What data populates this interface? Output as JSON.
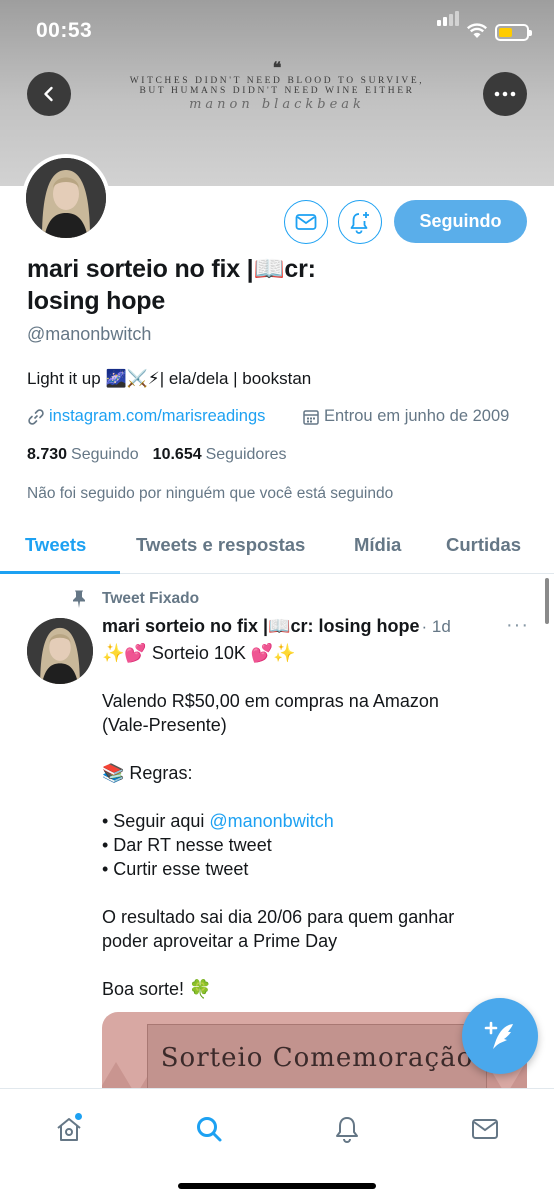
{
  "status_bar": {
    "time": "00:53"
  },
  "banner": {
    "quote_mark": "❝",
    "quote_line1": "Witches didn't need blood to survive,",
    "quote_line2": "but humans didn't need wine either",
    "signature": "manon blackbeak"
  },
  "profile": {
    "name_line1": "mari sorteio no fix |📖cr:",
    "name_line2": "losing hope",
    "handle": "@manonbwitch",
    "bio": "Light it up 🌌⚔️⚡| ela/dela | bookstan",
    "link": "instagram.com/marisreadings",
    "joined": "Entrou em junho de 2009",
    "following_count": "8.730",
    "following_label": "Seguindo",
    "followers_count": "10.654",
    "followers_label": "Seguidores",
    "not_followed_text": "Não foi seguido por ninguém que você está seguindo",
    "follow_button_label": "Seguindo"
  },
  "tabs": [
    {
      "label": "Tweets",
      "active": true
    },
    {
      "label": "Tweets e respostas",
      "active": false
    },
    {
      "label": "Mídia",
      "active": false
    },
    {
      "label": "Curtidas",
      "active": false
    }
  ],
  "tweet": {
    "pinned_label": "Tweet Fixado",
    "author": "mari sorteio no fix |📖cr: losing hope",
    "time": "· 1d",
    "more": "···",
    "line1": "✨💕 Sorteio 10K 💕✨",
    "line2": "Valendo R$50,00 em compras na Amazon",
    "line3": "(Vale-Presente)",
    "line4": "📚 Regras:",
    "line5_prefix": "• Seguir aqui ",
    "line5_mention": "@manonbwitch",
    "line6": "• Dar RT nesse tweet",
    "line7": "• Curtir esse tweet",
    "line8": "O resultado sai dia 20/06 para quem ganhar",
    "line9": "poder aproveitar a Prime Day",
    "line10": "Boa sorte! 🍀",
    "media_title": "Sorteio Comemoração"
  },
  "colors": {
    "accent": "#1da1f2",
    "follow_button": "#5aaeea",
    "secondary_text": "#657786",
    "primary_text": "#14171a"
  },
  "icons": {
    "back": "chevron-left-icon",
    "more": "more-horizontal-icon",
    "mail": "mail-icon",
    "bell": "bell-plus-icon",
    "link": "link-icon",
    "calendar": "calendar-icon",
    "pin": "pin-icon",
    "compose": "compose-tweet-icon",
    "nav_home": "home-icon",
    "nav_search": "search-icon",
    "nav_notifications": "bell-icon",
    "nav_messages": "mail-icon"
  }
}
